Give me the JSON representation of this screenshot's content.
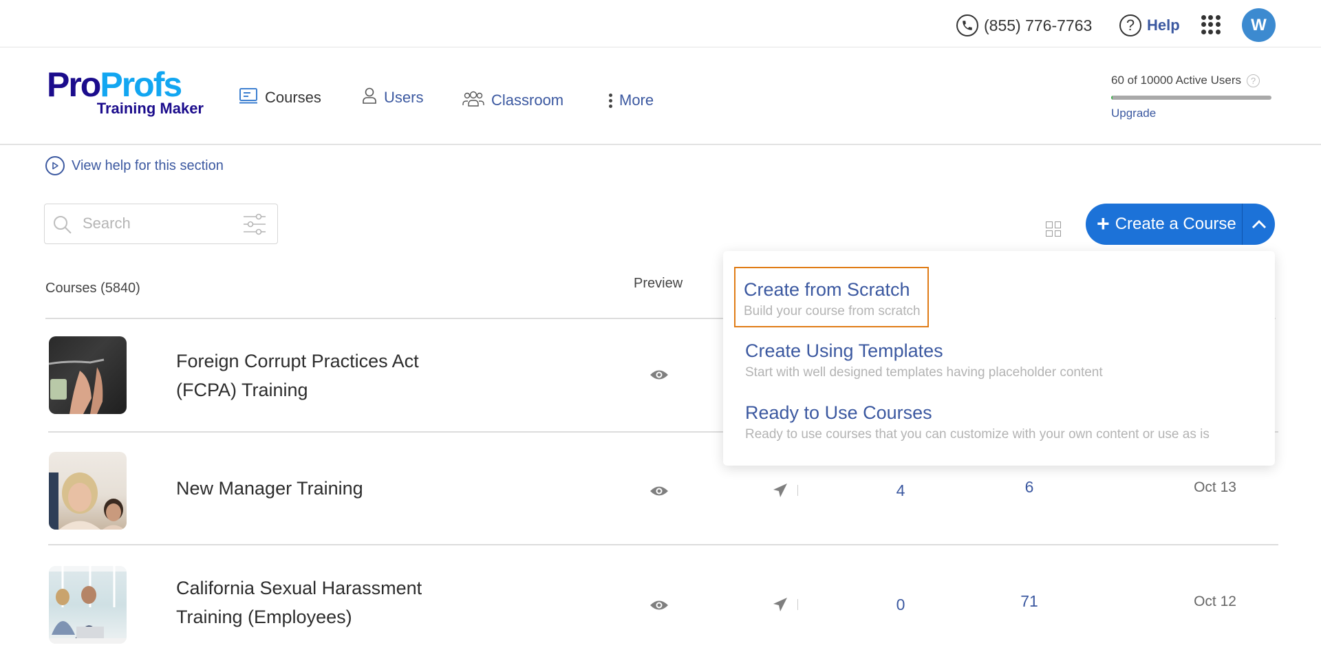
{
  "topbar": {
    "phone": "(855) 776-7763",
    "help_label": "Help",
    "avatar_initial": "W",
    "icons": {
      "phone": "phone-icon",
      "help": "question-circle-icon",
      "apps": "apps-grid-icon"
    }
  },
  "logo": {
    "brand_part1": "Pro",
    "brand_part2": "Profs",
    "product": "Training Maker"
  },
  "nav": {
    "items": [
      {
        "label": "Courses",
        "icon": "course-icon",
        "active": true
      },
      {
        "label": "Users",
        "icon": "user-icon"
      },
      {
        "label": "Classroom",
        "icon": "group-icon"
      },
      {
        "label": "More",
        "icon": "vertical-dots-icon"
      }
    ]
  },
  "license": {
    "active_users_text": "60 of 10000 Active Users",
    "used": 60,
    "total": 10000,
    "upgrade_label": "Upgrade"
  },
  "help_link": {
    "label": "View help for this section"
  },
  "search": {
    "placeholder": "Search",
    "value": ""
  },
  "create_button": {
    "label": "Create a Course",
    "toggle_state": "expanded"
  },
  "table": {
    "title": "Courses (5840)",
    "columns": {
      "preview": "Preview"
    },
    "rows": [
      {
        "title": "Foreign Corrupt Practices Act (FCPA) Training",
        "thumb": "handcuffs-money-image"
      },
      {
        "title": "New Manager Training",
        "thumb": "two-women-smiling-image",
        "count_a": "4",
        "count_b": "6",
        "date": "Oct 13"
      },
      {
        "title": "California Sexual Harassment Training (Employees)",
        "thumb": "coworkers-laptop-image",
        "count_a": "0",
        "count_b": "71",
        "date": "Oct 12"
      }
    ]
  },
  "create_menu": {
    "items": [
      {
        "title": "Create from Scratch",
        "description": "Build your course from scratch",
        "highlighted": true
      },
      {
        "title": "Create Using Templates",
        "description": "Start with well designed templates having placeholder content"
      },
      {
        "title": "Ready to Use Courses",
        "description": "Ready to use courses that you can customize with your own content or use as is"
      }
    ]
  },
  "colors": {
    "brand_dark": "#1b0c8c",
    "brand_light": "#12a6f1",
    "link": "#3b58a0",
    "primary_button": "#1c72d8",
    "highlight_outline": "#e07b15",
    "avatar": "#3c8ad0"
  }
}
